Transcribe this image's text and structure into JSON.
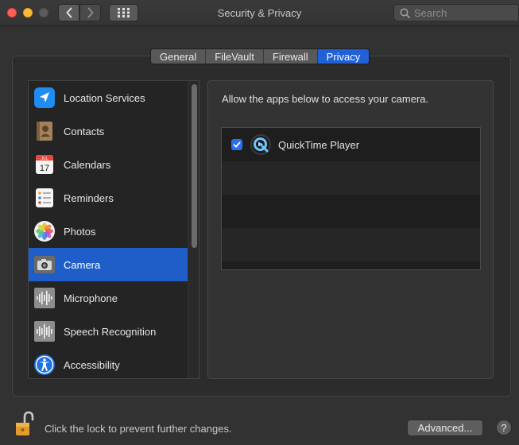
{
  "window": {
    "title": "Security & Privacy"
  },
  "search": {
    "placeholder": "Search"
  },
  "tabs": [
    {
      "label": "General",
      "active": false
    },
    {
      "label": "FileVault",
      "active": false
    },
    {
      "label": "Firewall",
      "active": false
    },
    {
      "label": "Privacy",
      "active": true
    }
  ],
  "sidebar": {
    "items": [
      {
        "label": "Location Services",
        "icon": "location-arrow-icon",
        "selected": false
      },
      {
        "label": "Contacts",
        "icon": "contacts-book-icon",
        "selected": false
      },
      {
        "label": "Calendars",
        "icon": "calendar-icon",
        "selected": false,
        "icon_text_month": "JUL",
        "icon_text_day": "17"
      },
      {
        "label": "Reminders",
        "icon": "reminders-list-icon",
        "selected": false
      },
      {
        "label": "Photos",
        "icon": "photos-flower-icon",
        "selected": false
      },
      {
        "label": "Camera",
        "icon": "camera-icon",
        "selected": true
      },
      {
        "label": "Microphone",
        "icon": "microphone-waveform-icon",
        "selected": false
      },
      {
        "label": "Speech Recognition",
        "icon": "speech-waveform-icon",
        "selected": false
      },
      {
        "label": "Accessibility",
        "icon": "accessibility-person-icon",
        "selected": false
      }
    ]
  },
  "content": {
    "description": "Allow the apps below to access your camera.",
    "apps": [
      {
        "name": "QuickTime Player",
        "checked": true,
        "icon": "quicktime-icon"
      }
    ]
  },
  "footer": {
    "lock_text": "Click the lock to prevent further changes.",
    "advanced_label": "Advanced...",
    "help_label": "?"
  },
  "colors": {
    "accent": "#2160d6",
    "selection": "#1f5ec9",
    "close": "#fe5f57",
    "minimize": "#febc2e"
  }
}
